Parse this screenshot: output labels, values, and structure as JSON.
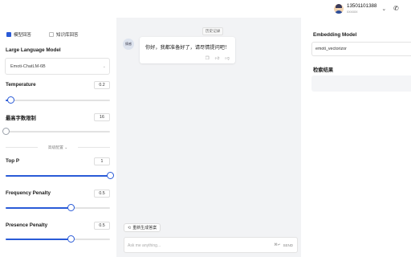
{
  "header": {
    "user_phone": "13501101388",
    "user_sub": "xxxxxx"
  },
  "sidebar": {
    "modes": [
      {
        "label": "模型回答",
        "checked": true
      },
      {
        "label": "知识库回答",
        "checked": false
      }
    ],
    "model_label": "Large Language Model",
    "model_value": "Emoti-ChatLM-6B",
    "temperature": {
      "label": "Temperature",
      "value": "0.2",
      "fraction": 0.05
    },
    "max_chars": {
      "label": "最高字数限制",
      "value": "16",
      "fraction": 0.0
    },
    "advanced_label": "高级配置",
    "top_p": {
      "label": "Top P",
      "value": "1",
      "fraction": 1.0
    },
    "frequency_penalty": {
      "label": "Frequency Penalty",
      "value": "0.5",
      "fraction": 0.63
    },
    "presence_penalty": {
      "label": "Presence Penalty",
      "value": "0.5",
      "fraction": 0.63
    }
  },
  "chat": {
    "history_label": "历史记录",
    "bot_avatar_text": "情感",
    "bot_message": "你好，我都准备好了，请尽情提问吧！",
    "regenerate_label": "重新生成答案",
    "input_placeholder": "Ask me anything...",
    "send_label": "SEND",
    "send_shortcut": "⌘↵"
  },
  "right_panel": {
    "embedding_label": "Embedding Model",
    "embedding_value": "emoti_vectorizor",
    "results_label": "检索结果"
  },
  "colors": {
    "accent": "#2a5bd7",
    "canvas": "#f2f3f5"
  }
}
